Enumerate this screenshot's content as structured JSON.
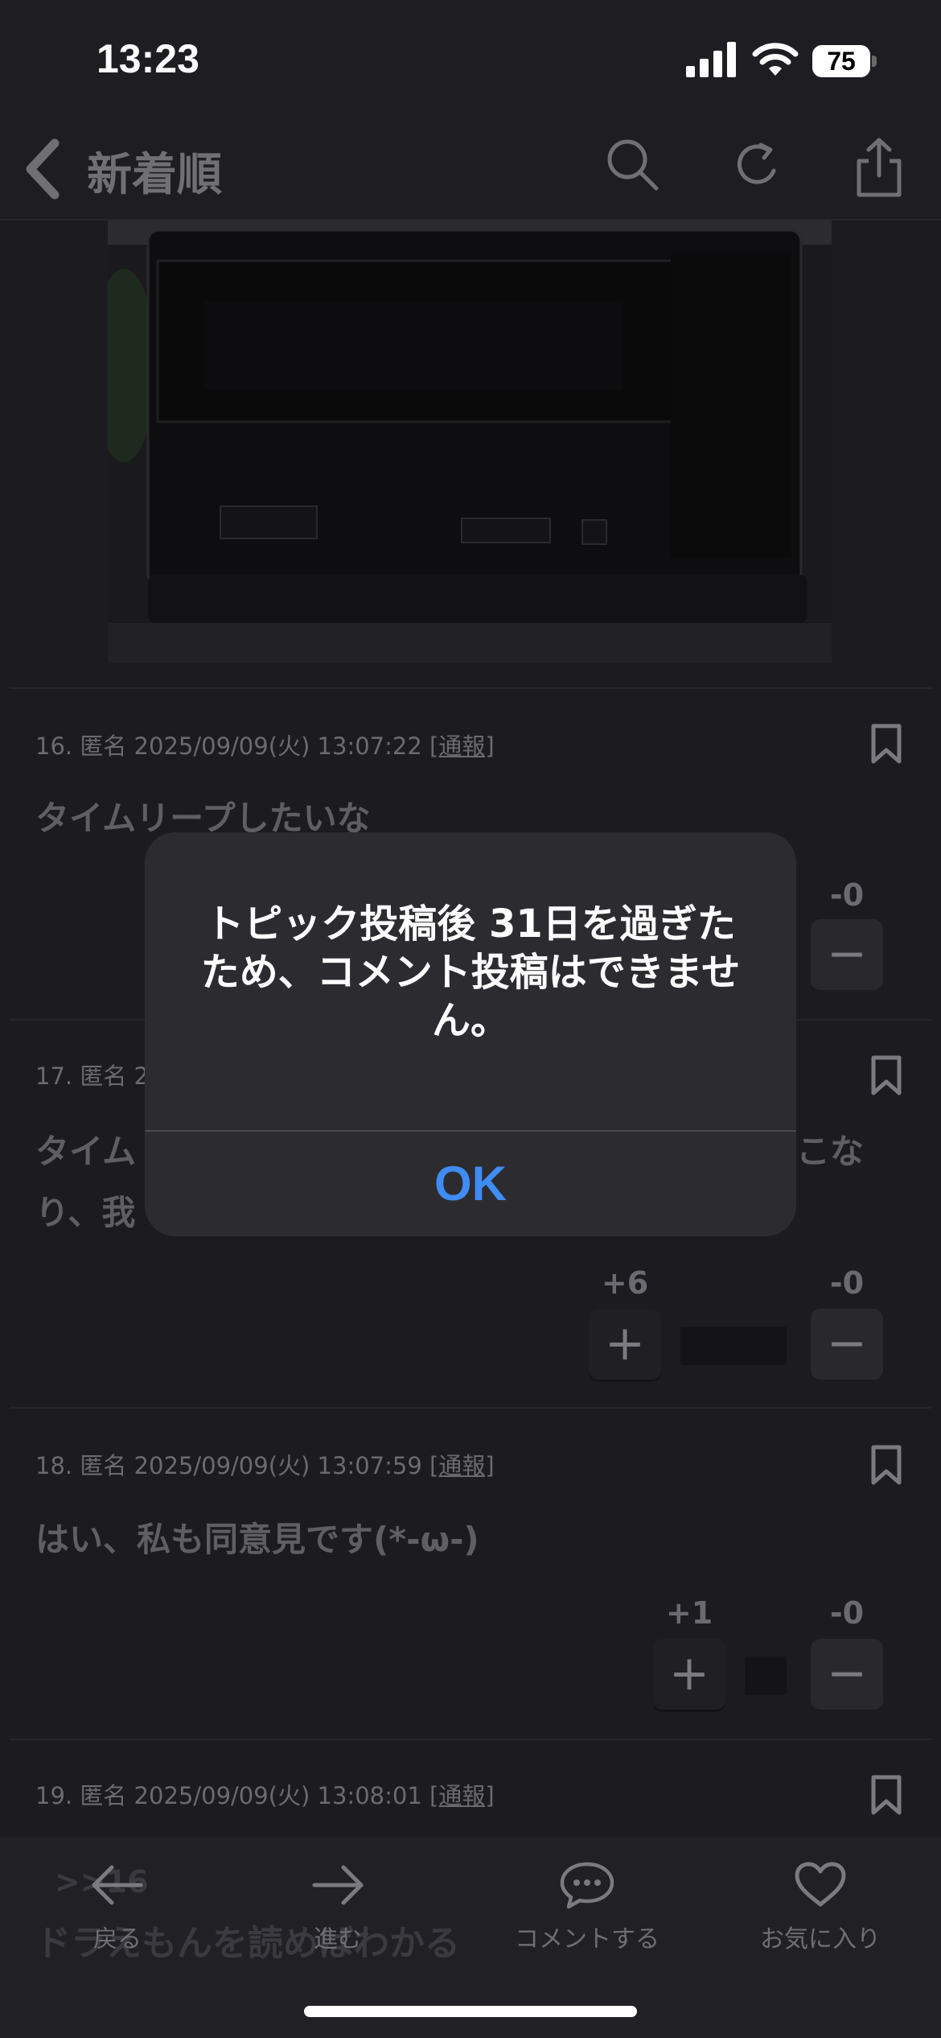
{
  "status_bar": {
    "time": "13:23",
    "battery": "75"
  },
  "nav": {
    "title": "新着順"
  },
  "comments": [
    {
      "meta": "16. 匿名 2025/09/09(火) 13:07:22 ",
      "report": "[通報]",
      "text": "タイムリープしたいな",
      "plus": "",
      "minus": "-0"
    },
    {
      "meta": "17. 匿名 2",
      "report": "",
      "text_line1_left": "タイム",
      "text_line1_right": "こな",
      "text_line2": "り、我",
      "plus": "+6",
      "minus": "-0"
    },
    {
      "meta": "18. 匿名 2025/09/09(火) 13:07:59 ",
      "report": "[通報]",
      "text": "はい、私も同意見です(*-ω-)",
      "plus": "+1",
      "minus": "-0"
    },
    {
      "meta": "19. 匿名 2025/09/09(火) 13:08:01 ",
      "report": "[通報]",
      "text_line1": ">>16",
      "text_line2": "ドラえもんを読めばわかる"
    }
  ],
  "vote_symbols": {
    "plus": "+",
    "minus": "−"
  },
  "tabbar": {
    "back": "戻る",
    "forward": "進む",
    "comment": "コメントする",
    "favorite": "お気に入り"
  },
  "alert": {
    "message": "トピック投稿後 31日を過ぎたため、コメント投稿はできません。",
    "ok": "OK"
  }
}
